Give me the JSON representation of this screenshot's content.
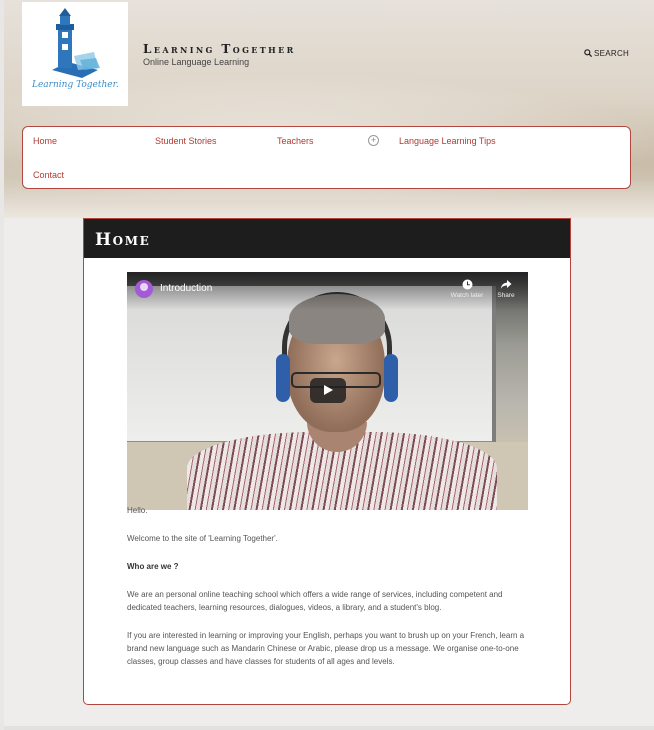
{
  "site": {
    "logo_text": "Learning Together.",
    "title": "Learning Together",
    "tagline": "Online Language Learning"
  },
  "header": {
    "search_label": "SEARCH"
  },
  "nav": {
    "items": [
      {
        "label": "Home"
      },
      {
        "label": "Student Stories"
      },
      {
        "label": "Teachers"
      },
      {
        "label": "Language Learning Tips"
      },
      {
        "label": "Contact"
      }
    ],
    "more_icon": "plus-circle-icon"
  },
  "page": {
    "title": "Home",
    "video": {
      "title": "Introduction",
      "watch_later": "Watch later",
      "share": "Share"
    },
    "paragraphs": [
      "Hello.",
      "Welcome to the site of 'Learning Together'.",
      "Who are we ?",
      "We are an personal online teaching school which offers a wide range of services, including competent and dedicated teachers, learning resources, dialogues, videos, a library, and a student's blog.",
      "If you are interested in learning or improving your English, perhaps you want to brush up on your French, learn a brand new language such as Mandarin Chinese or Arabic, please drop us a message. We organise one-to-one classes, group classes and have classes for students of all ages and levels."
    ]
  },
  "colors": {
    "accent": "#b13a33",
    "header_bar": "#1d1d1d",
    "logo_blue": "#3a8fc9"
  }
}
